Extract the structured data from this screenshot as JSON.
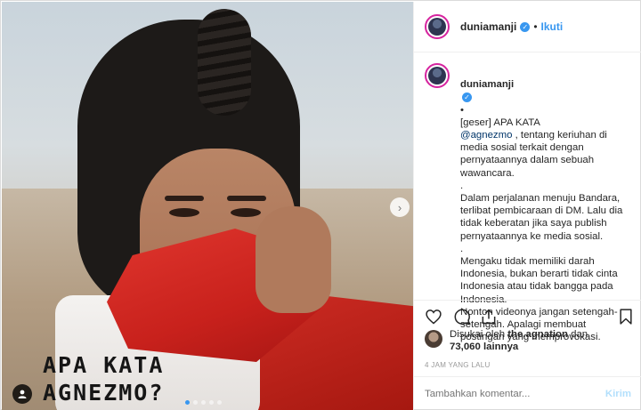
{
  "post": {
    "image_caption_lines": [
      "APA KATA",
      "AGNEZMO?"
    ],
    "carousel_dots": 5,
    "active_dot": 0
  },
  "header": {
    "username": "duniamanji",
    "verified_symbol": "✓",
    "separator": "•",
    "follow_label": "Ikuti"
  },
  "caption": {
    "username": "duniamanji",
    "verified_symbol": "✓",
    "separator": "•",
    "intro": "[geser] APA KATA",
    "mention": "@agnezmo",
    "p1_rest": " , tentang keriuhan di media sosial terkait dengan pernyataannya dalam sebuah wawancara.",
    "p2": ".\nDalam perjalanan menuju Bandara, terlibat pembicaraan di DM. Lalu dia tidak keberatan jika saya publish pernyataannya ke media sosial.",
    "p3": ".\nMengaku tidak memiliki darah Indonesia, bukan berarti tidak cinta Indonesia atau tidak bangga pada Indonesia.\nNonton videonya jangan setengah-setengah. Apalagi membuat postingan yang memprovokasi."
  },
  "likes": {
    "prefix": "Disukai oleh",
    "user": "the.agnation",
    "conj": "dan",
    "count": "73,060 lainnya"
  },
  "timestamp": "4 JAM YANG LALU",
  "comment_box": {
    "placeholder": "Tambahkan komentar...",
    "post_label": "Kirim"
  },
  "colors": {
    "accent": "#3897f0",
    "mention": "#003569",
    "post_disabled": "#b2dffc"
  }
}
